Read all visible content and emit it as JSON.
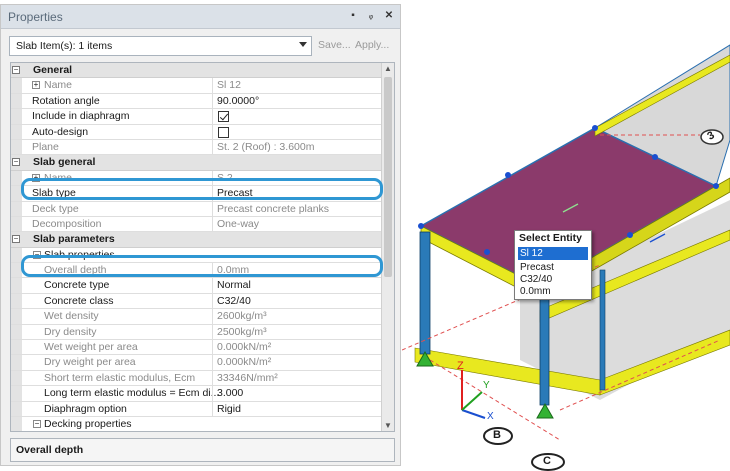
{
  "panel": {
    "title": "Properties",
    "title_icons": [
      "pin-icon",
      "dock-icon",
      "close-icon"
    ],
    "title_icon_glyphs": [
      "▪",
      "ᵩ",
      "✕"
    ],
    "selector_value": "Slab Item(s): 1 items",
    "save_label": "Save...",
    "apply_label": "Apply...",
    "description": "Overall depth"
  },
  "grid": {
    "rows": [
      {
        "kind": "cat",
        "label": "General"
      },
      {
        "kind": "prop",
        "name": "Name",
        "value": "Sl 12",
        "readonly": true,
        "expander": true
      },
      {
        "kind": "prop",
        "name": "Rotation angle",
        "value": "90.0000°"
      },
      {
        "kind": "check",
        "name": "Include in diaphragm",
        "checked": true
      },
      {
        "kind": "check",
        "name": "Auto-design",
        "checked": false
      },
      {
        "kind": "prop",
        "name": "Plane",
        "value": "St. 2 (Roof) : 3.600m",
        "readonly": true
      },
      {
        "kind": "cat",
        "label": "Slab general"
      },
      {
        "kind": "prop",
        "name": "Name",
        "value": "S 2",
        "readonly": true,
        "expander": true
      },
      {
        "kind": "prop",
        "name": "Slab type",
        "value": "Precast"
      },
      {
        "kind": "prop",
        "name": "Deck type",
        "value": "Precast concrete planks",
        "readonly": true
      },
      {
        "kind": "prop",
        "name": "Decomposition",
        "value": "One-way",
        "readonly": true
      },
      {
        "kind": "cat",
        "label": "Slab parameters"
      },
      {
        "kind": "sub",
        "name": "Slab properties"
      },
      {
        "kind": "prop",
        "name": "Overall depth",
        "value": "0.0mm",
        "readonly": true,
        "indent": 2
      },
      {
        "kind": "prop",
        "name": "Concrete type",
        "value": "Normal",
        "indent": 2
      },
      {
        "kind": "prop",
        "name": "Concrete class",
        "value": "C32/40",
        "indent": 2
      },
      {
        "kind": "prop",
        "name": "Wet density",
        "value": "2600kg/m³",
        "readonly": true,
        "indent": 2
      },
      {
        "kind": "prop",
        "name": "Dry density",
        "value": "2500kg/m³",
        "readonly": true,
        "indent": 2
      },
      {
        "kind": "prop",
        "name": "Wet weight per area",
        "value": "0.000kN/m²",
        "readonly": true,
        "indent": 2
      },
      {
        "kind": "prop",
        "name": "Dry weight per area",
        "value": "0.000kN/m²",
        "readonly": true,
        "indent": 2
      },
      {
        "kind": "prop",
        "name": "Short term elastic modulus, Ecm",
        "value": "33346N/mm²",
        "readonly": true,
        "indent": 2
      },
      {
        "kind": "prop",
        "name": "Long term elastic modulus = Ecm di...",
        "value": "3.000",
        "indent": 2
      },
      {
        "kind": "prop",
        "name": "Diaphragm option",
        "value": "Rigid",
        "indent": 2
      },
      {
        "kind": "sub",
        "name": "Decking properties"
      }
    ]
  },
  "view": {
    "popup_title": "Select Entity",
    "popup_selected": "Sl 12",
    "popup_lines": [
      "Precast",
      "C32/40",
      "0.0mm"
    ],
    "grid_labels": {
      "three": "3",
      "b": "B",
      "c": "C"
    },
    "axes": {
      "x": "X",
      "y": "Y",
      "z": "Z"
    }
  },
  "colors": {
    "highlight": "#2f97d3",
    "slab_selected": "#8b3a6b",
    "beam": "#e8e81f",
    "column": "#2a7ab8",
    "support": "#33b233",
    "gridline": "#e05050"
  }
}
